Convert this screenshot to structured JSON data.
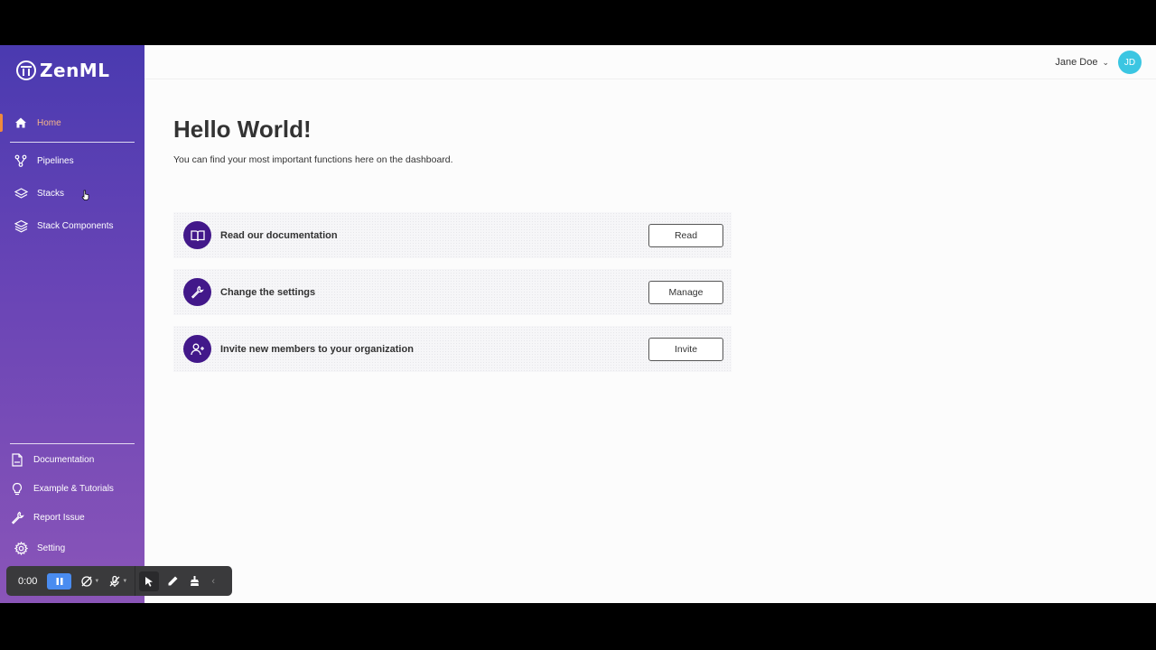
{
  "app": {
    "name": "ZenML"
  },
  "sidebar": {
    "items": [
      {
        "label": "Home",
        "icon": "home-icon",
        "active": true
      },
      {
        "label": "Pipelines",
        "icon": "pipeline-icon"
      },
      {
        "label": "Stacks",
        "icon": "stack-icon"
      },
      {
        "label": "Stack Components",
        "icon": "layers-icon"
      }
    ],
    "bottom_items": [
      {
        "label": "Documentation",
        "icon": "document-icon"
      },
      {
        "label": "Example & Tutorials",
        "icon": "lightbulb-icon"
      },
      {
        "label": "Report Issue",
        "icon": "wrench-icon"
      },
      {
        "label": "Setting",
        "icon": "gear-icon"
      }
    ]
  },
  "header": {
    "user_name": "Jane Doe",
    "avatar_initials": "JD",
    "avatar_color": "#3bc6e2"
  },
  "main": {
    "title": "Hello World!",
    "subtitle": "You can find your most important functions here on the dashboard.",
    "cards": [
      {
        "label": "Read our documentation",
        "button": "Read",
        "icon": "book-icon"
      },
      {
        "label": "Change the settings",
        "button": "Manage",
        "icon": "wrench-icon"
      },
      {
        "label": "Invite new members to your organization",
        "button": "Invite",
        "icon": "user-add-icon"
      }
    ]
  },
  "recorder": {
    "time": "0:00"
  },
  "colors": {
    "accent": "#42188a",
    "active_nav": "#f5b58a",
    "sidebar_top": "#4a3ab0",
    "sidebar_bottom": "#8a55b8"
  }
}
